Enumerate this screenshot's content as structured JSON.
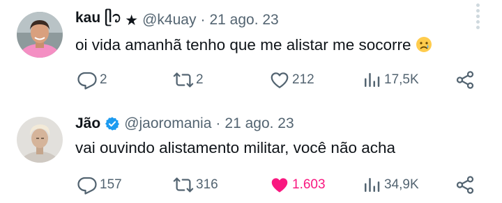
{
  "colors": {
    "text_primary": "#0f1419",
    "text_secondary": "#536471",
    "like_active": "#f91880",
    "verified": "#1d9bf0"
  },
  "tweets": [
    {
      "author": {
        "display_name": "kau ᥫ᭡",
        "name_suffix": "★",
        "handle": "@k4uay",
        "verified": false
      },
      "date": "21 ago. 23",
      "text": "oi vida amanhã tenho que me alistar me socorre",
      "emoji": "crying-face-emoji",
      "stats": {
        "replies": "2",
        "retweets": "2",
        "likes": "212",
        "views": "17,5K"
      },
      "liked": false
    },
    {
      "author": {
        "display_name": "Jão",
        "name_suffix": "",
        "handle": "@jaoromania",
        "verified": true
      },
      "date": "21 ago. 23",
      "text": "vai ouvindo alistamento militar, você não acha",
      "stats": {
        "replies": "157",
        "retweets": "316",
        "likes": "1.603",
        "views": "34,9K"
      },
      "liked": true
    }
  ],
  "separator": "·"
}
